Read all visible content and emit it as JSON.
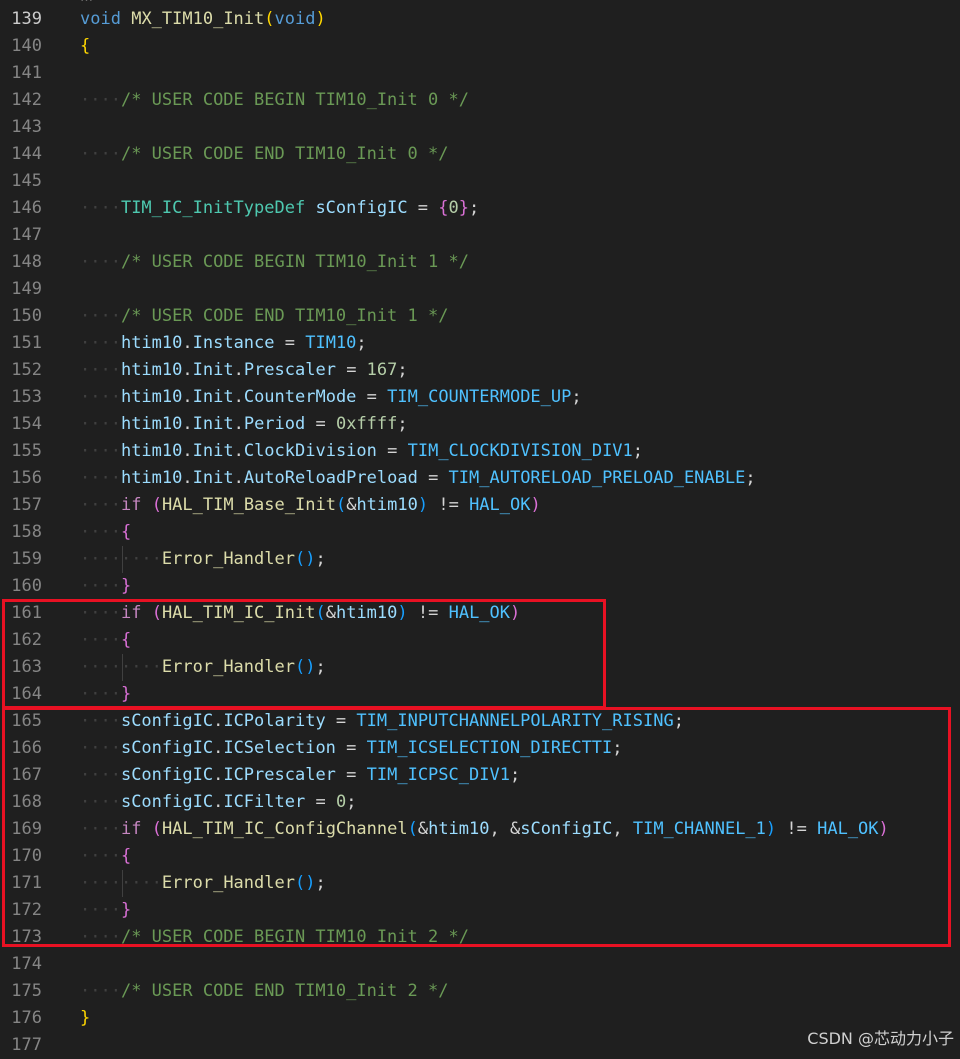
{
  "header_clip_text": "…",
  "watermark": "CSDN @芯动力小子",
  "colors": {
    "background": "#1f1f1f",
    "line_number": "#858585",
    "keyword": "#569cd6",
    "control": "#c586c0",
    "function": "#dcdcaa",
    "variable": "#9cdcfe",
    "type": "#4ec9b0",
    "macro": "#4fc1ff",
    "number": "#b5cea8",
    "comment": "#6a9955",
    "highlight_box": "#e81123"
  },
  "highlight_boxes": [
    {
      "from_line": 161,
      "to_line": 164
    },
    {
      "from_line": 165,
      "to_line": 173
    }
  ],
  "active_line": 139,
  "lines": [
    {
      "n": "139",
      "indent": 0,
      "tokens": [
        [
          "void",
          "kw"
        ],
        [
          " ",
          "op"
        ],
        [
          "MX_TIM10_Init",
          "fn"
        ],
        [
          "(",
          "p1"
        ],
        [
          "void",
          "kw"
        ],
        [
          ")",
          "p1"
        ]
      ]
    },
    {
      "n": "140",
      "indent": 0,
      "tokens": [
        [
          "{",
          "p1"
        ]
      ]
    },
    {
      "n": "141",
      "indent": 0,
      "tokens": []
    },
    {
      "n": "142",
      "indent": 1,
      "tokens": [
        [
          "/* USER CODE BEGIN TIM10_Init 0 */",
          "cmt"
        ]
      ]
    },
    {
      "n": "143",
      "indent": 0,
      "tokens": []
    },
    {
      "n": "144",
      "indent": 1,
      "tokens": [
        [
          "/* USER CODE END TIM10_Init 0 */",
          "cmt"
        ]
      ]
    },
    {
      "n": "145",
      "indent": 0,
      "tokens": []
    },
    {
      "n": "146",
      "indent": 1,
      "tokens": [
        [
          "TIM_IC_InitTypeDef",
          "type"
        ],
        [
          " ",
          "op"
        ],
        [
          "sConfigIC",
          "var"
        ],
        [
          " = ",
          "op"
        ],
        [
          "{",
          "p2"
        ],
        [
          "0",
          "num"
        ],
        [
          "}",
          "p2"
        ],
        [
          ";",
          "op"
        ]
      ]
    },
    {
      "n": "147",
      "indent": 0,
      "tokens": []
    },
    {
      "n": "148",
      "indent": 1,
      "tokens": [
        [
          "/* USER CODE BEGIN TIM10_Init 1 */",
          "cmt"
        ]
      ]
    },
    {
      "n": "149",
      "indent": 0,
      "tokens": []
    },
    {
      "n": "150",
      "indent": 1,
      "tokens": [
        [
          "/* USER CODE END TIM10_Init 1 */",
          "cmt"
        ]
      ]
    },
    {
      "n": "151",
      "indent": 1,
      "tokens": [
        [
          "htim10",
          "var"
        ],
        [
          ".",
          "op"
        ],
        [
          "Instance",
          "var"
        ],
        [
          " = ",
          "op"
        ],
        [
          "TIM10",
          "mac"
        ],
        [
          ";",
          "op"
        ]
      ]
    },
    {
      "n": "152",
      "indent": 1,
      "tokens": [
        [
          "htim10",
          "var"
        ],
        [
          ".",
          "op"
        ],
        [
          "Init",
          "var"
        ],
        [
          ".",
          "op"
        ],
        [
          "Prescaler",
          "var"
        ],
        [
          " = ",
          "op"
        ],
        [
          "167",
          "num"
        ],
        [
          ";",
          "op"
        ]
      ]
    },
    {
      "n": "153",
      "indent": 1,
      "tokens": [
        [
          "htim10",
          "var"
        ],
        [
          ".",
          "op"
        ],
        [
          "Init",
          "var"
        ],
        [
          ".",
          "op"
        ],
        [
          "CounterMode",
          "var"
        ],
        [
          " = ",
          "op"
        ],
        [
          "TIM_COUNTERMODE_UP",
          "mac"
        ],
        [
          ";",
          "op"
        ]
      ]
    },
    {
      "n": "154",
      "indent": 1,
      "tokens": [
        [
          "htim10",
          "var"
        ],
        [
          ".",
          "op"
        ],
        [
          "Init",
          "var"
        ],
        [
          ".",
          "op"
        ],
        [
          "Period",
          "var"
        ],
        [
          " = ",
          "op"
        ],
        [
          "0xffff",
          "num"
        ],
        [
          ";",
          "op"
        ]
      ]
    },
    {
      "n": "155",
      "indent": 1,
      "tokens": [
        [
          "htim10",
          "var"
        ],
        [
          ".",
          "op"
        ],
        [
          "Init",
          "var"
        ],
        [
          ".",
          "op"
        ],
        [
          "ClockDivision",
          "var"
        ],
        [
          " = ",
          "op"
        ],
        [
          "TIM_CLOCKDIVISION_DIV1",
          "mac"
        ],
        [
          ";",
          "op"
        ]
      ]
    },
    {
      "n": "156",
      "indent": 1,
      "tokens": [
        [
          "htim10",
          "var"
        ],
        [
          ".",
          "op"
        ],
        [
          "Init",
          "var"
        ],
        [
          ".",
          "op"
        ],
        [
          "AutoReloadPreload",
          "var"
        ],
        [
          " = ",
          "op"
        ],
        [
          "TIM_AUTORELOAD_PRELOAD_ENABLE",
          "mac"
        ],
        [
          ";",
          "op"
        ]
      ]
    },
    {
      "n": "157",
      "indent": 1,
      "tokens": [
        [
          "if",
          "ctl"
        ],
        [
          " ",
          "op"
        ],
        [
          "(",
          "p2"
        ],
        [
          "HAL_TIM_Base_Init",
          "fn"
        ],
        [
          "(",
          "p3"
        ],
        [
          "&",
          "op"
        ],
        [
          "htim10",
          "var"
        ],
        [
          ")",
          "p3"
        ],
        [
          " != ",
          "op"
        ],
        [
          "HAL_OK",
          "mac"
        ],
        [
          ")",
          "p2"
        ]
      ]
    },
    {
      "n": "158",
      "indent": 1,
      "tokens": [
        [
          "{",
          "p2"
        ]
      ]
    },
    {
      "n": "159",
      "indent": 2,
      "tokens": [
        [
          "Error_Handler",
          "fn"
        ],
        [
          "(",
          "p3"
        ],
        [
          ")",
          "p3"
        ],
        [
          ";",
          "op"
        ]
      ]
    },
    {
      "n": "160",
      "indent": 1,
      "tokens": [
        [
          "}",
          "p2"
        ]
      ]
    },
    {
      "n": "161",
      "indent": 1,
      "tokens": [
        [
          "if",
          "ctl"
        ],
        [
          " ",
          "op"
        ],
        [
          "(",
          "p2"
        ],
        [
          "HAL_TIM_IC_Init",
          "fn"
        ],
        [
          "(",
          "p3"
        ],
        [
          "&",
          "op"
        ],
        [
          "htim10",
          "var"
        ],
        [
          ")",
          "p3"
        ],
        [
          " != ",
          "op"
        ],
        [
          "HAL_OK",
          "mac"
        ],
        [
          ")",
          "p2"
        ]
      ]
    },
    {
      "n": "162",
      "indent": 1,
      "tokens": [
        [
          "{",
          "p2"
        ]
      ]
    },
    {
      "n": "163",
      "indent": 2,
      "tokens": [
        [
          "Error_Handler",
          "fn"
        ],
        [
          "(",
          "p3"
        ],
        [
          ")",
          "p3"
        ],
        [
          ";",
          "op"
        ]
      ]
    },
    {
      "n": "164",
      "indent": 1,
      "tokens": [
        [
          "}",
          "p2"
        ]
      ]
    },
    {
      "n": "165",
      "indent": 1,
      "tokens": [
        [
          "sConfigIC",
          "var"
        ],
        [
          ".",
          "op"
        ],
        [
          "ICPolarity",
          "var"
        ],
        [
          " = ",
          "op"
        ],
        [
          "TIM_INPUTCHANNELPOLARITY_RISING",
          "mac"
        ],
        [
          ";",
          "op"
        ]
      ]
    },
    {
      "n": "166",
      "indent": 1,
      "tokens": [
        [
          "sConfigIC",
          "var"
        ],
        [
          ".",
          "op"
        ],
        [
          "ICSelection",
          "var"
        ],
        [
          " = ",
          "op"
        ],
        [
          "TIM_ICSELECTION_DIRECTTI",
          "mac"
        ],
        [
          ";",
          "op"
        ]
      ]
    },
    {
      "n": "167",
      "indent": 1,
      "tokens": [
        [
          "sConfigIC",
          "var"
        ],
        [
          ".",
          "op"
        ],
        [
          "ICPrescaler",
          "var"
        ],
        [
          " = ",
          "op"
        ],
        [
          "TIM_ICPSC_DIV1",
          "mac"
        ],
        [
          ";",
          "op"
        ]
      ]
    },
    {
      "n": "168",
      "indent": 1,
      "tokens": [
        [
          "sConfigIC",
          "var"
        ],
        [
          ".",
          "op"
        ],
        [
          "ICFilter",
          "var"
        ],
        [
          " = ",
          "op"
        ],
        [
          "0",
          "num"
        ],
        [
          ";",
          "op"
        ]
      ]
    },
    {
      "n": "169",
      "indent": 1,
      "tokens": [
        [
          "if",
          "ctl"
        ],
        [
          " ",
          "op"
        ],
        [
          "(",
          "p2"
        ],
        [
          "HAL_TIM_IC_ConfigChannel",
          "fn"
        ],
        [
          "(",
          "p3"
        ],
        [
          "&",
          "op"
        ],
        [
          "htim10",
          "var"
        ],
        [
          ", ",
          "op"
        ],
        [
          "&",
          "op"
        ],
        [
          "sConfigIC",
          "var"
        ],
        [
          ", ",
          "op"
        ],
        [
          "TIM_CHANNEL_1",
          "mac"
        ],
        [
          ")",
          "p3"
        ],
        [
          " != ",
          "op"
        ],
        [
          "HAL_OK",
          "mac"
        ],
        [
          ")",
          "p2"
        ]
      ]
    },
    {
      "n": "170",
      "indent": 1,
      "tokens": [
        [
          "{",
          "p2"
        ]
      ]
    },
    {
      "n": "171",
      "indent": 2,
      "tokens": [
        [
          "Error_Handler",
          "fn"
        ],
        [
          "(",
          "p3"
        ],
        [
          ")",
          "p3"
        ],
        [
          ";",
          "op"
        ]
      ]
    },
    {
      "n": "172",
      "indent": 1,
      "tokens": [
        [
          "}",
          "p2"
        ]
      ]
    },
    {
      "n": "173",
      "indent": 1,
      "tokens": [
        [
          "/* USER CODE BEGIN TIM10_Init 2 */",
          "cmt"
        ]
      ]
    },
    {
      "n": "174",
      "indent": 0,
      "tokens": []
    },
    {
      "n": "175",
      "indent": 1,
      "tokens": [
        [
          "/* USER CODE END TIM10_Init 2 */",
          "cmt"
        ]
      ]
    },
    {
      "n": "176",
      "indent": 0,
      "tokens": [
        [
          "}",
          "p1"
        ]
      ]
    },
    {
      "n": "177",
      "indent": 0,
      "tokens": []
    }
  ]
}
